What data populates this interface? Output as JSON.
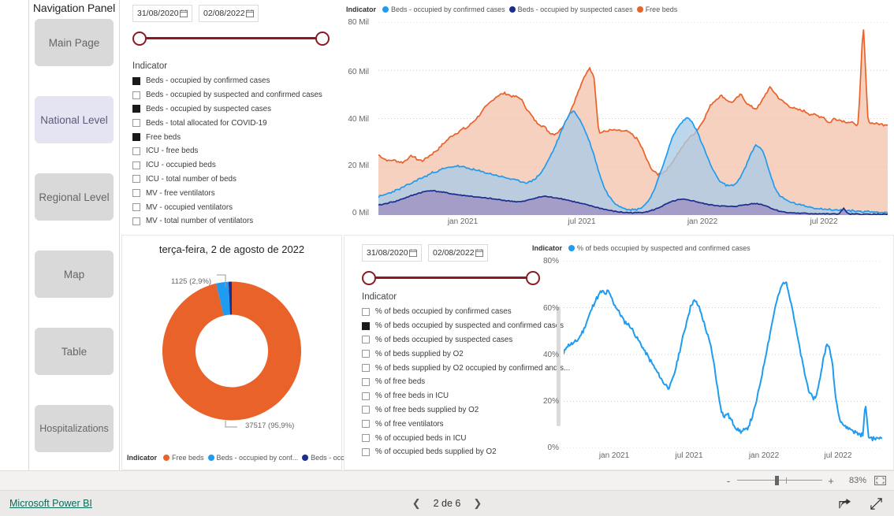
{
  "nav": {
    "title": "Navigation Panel",
    "items": [
      {
        "label": "Main Page",
        "active": false
      },
      {
        "label": "National Level",
        "active": true
      },
      {
        "label": "Regional Level",
        "active": false
      },
      {
        "label": "Map",
        "active": false
      },
      {
        "label": "Table",
        "active": false
      },
      {
        "label": "Hospitalizations",
        "active": false
      }
    ]
  },
  "slicer_top": {
    "start_date": "31/08/2020",
    "end_date": "02/08/2022",
    "indicator_header": "Indicator",
    "indicators": [
      {
        "label": "Beds - occupied by confirmed cases",
        "checked": true
      },
      {
        "label": "Beds - occupied by suspected and confirmed cases",
        "checked": false
      },
      {
        "label": "Beds - occupied by suspected cases",
        "checked": true
      },
      {
        "label": "Beds - total allocated for COVID-19",
        "checked": false
      },
      {
        "label": "Free beds",
        "checked": true
      },
      {
        "label": "ICU - free beds",
        "checked": false
      },
      {
        "label": "ICU - occupied beds",
        "checked": false
      },
      {
        "label": "ICU - total number of beds",
        "checked": false
      },
      {
        "label": "MV - free ventilators",
        "checked": false
      },
      {
        "label": "MV - occupied ventilators",
        "checked": false
      },
      {
        "label": "MV - total number of ventilators",
        "checked": false
      }
    ]
  },
  "slicer_bottom": {
    "start_date": "31/08/2020",
    "end_date": "02/08/2022",
    "indicator_header": "Indicator",
    "indicators": [
      {
        "label": "% of beds occupied by confirmed cases",
        "checked": false
      },
      {
        "label": "% of beds occupied by suspected and confirmed cases",
        "checked": true
      },
      {
        "label": "% of beds occupied by suspected cases",
        "checked": false
      },
      {
        "label": "% of beds supplied by O2",
        "checked": false
      },
      {
        "label": "% of beds supplied by O2 occupied by confirmed and s...",
        "checked": false
      },
      {
        "label": "% of free beds",
        "checked": false
      },
      {
        "label": "% of free beds in ICU",
        "checked": false
      },
      {
        "label": "% of free beds supplied by O2",
        "checked": false
      },
      {
        "label": "% of free ventilators",
        "checked": false
      },
      {
        "label": "% of occupied beds in ICU",
        "checked": false
      },
      {
        "label": "% of occupied beds supplied by O2",
        "checked": false
      }
    ]
  },
  "colors": {
    "orange": "#E8622A",
    "orange_fill": "#F5C4AE",
    "blue": "#1F9BF0",
    "blue_fill": "#9FC8E8",
    "navy": "#1B2E8E",
    "navy_fill": "#9D8FC0",
    "accent_red": "#8B1A24",
    "nav_active": "#E4E4F2",
    "nav_button": "#D9D9D9",
    "brand_green": "#096B5A"
  },
  "chart_area": {
    "type": "area",
    "legend_title": "Indicator",
    "legend_position": "top",
    "series": [
      {
        "name": "Beds - occupied by confirmed cases",
        "color": "#1F9BF0"
      },
      {
        "name": "Beds - occupied by suspected cases",
        "color": "#1B2E8E"
      },
      {
        "name": "Free beds",
        "color": "#E8622A"
      }
    ],
    "ylabel": "",
    "xlabel": "",
    "ylim": [
      0,
      80000
    ],
    "yticks": [
      "0 Mil",
      "20 Mil",
      "40 Mil",
      "60 Mil",
      "80 Mil"
    ],
    "ytick_values": [
      0,
      20000,
      40000,
      60000,
      80000
    ],
    "xticks": [
      "jan 2021",
      "jul 2021",
      "jan 2022",
      "jul 2022"
    ],
    "grid": true,
    "x_start": "2020-08-31",
    "x_end": "2022-08-02",
    "data": {
      "free_beds": [
        25000,
        23500,
        22500,
        22800,
        22200,
        21800,
        23500,
        24500,
        23000,
        22500,
        24000,
        25500,
        27000,
        29000,
        31000,
        33000,
        34000,
        35500,
        36000,
        38000,
        40000,
        42500,
        45000,
        47000,
        49000,
        50000,
        50500,
        49500,
        49000,
        48500,
        45000,
        42000,
        39000,
        37500,
        36500,
        34000,
        33500,
        35000,
        38000,
        42000,
        47000,
        52000,
        57000,
        61000,
        58000,
        34000,
        34500,
        35000,
        35200,
        35000,
        34800,
        34500,
        33000,
        31000,
        27000,
        22000,
        18500,
        17000,
        17500,
        19000,
        22000,
        25000,
        28000,
        31000,
        33000,
        35000,
        38000,
        42000,
        46000,
        48000,
        49500,
        48000,
        46500,
        48000,
        50000,
        47000,
        45000,
        44000,
        46000,
        50000,
        53000,
        50500,
        48000,
        46500,
        45000,
        44000,
        43500,
        43000,
        42000,
        41500,
        41000,
        40500,
        38000,
        40000,
        39500,
        39000,
        38500,
        38000,
        37500,
        80000,
        38500,
        38000,
        37800,
        37600,
        37517
      ],
      "occupied_confirmed": [
        7500,
        8200,
        9000,
        9800,
        10500,
        11500,
        12500,
        13500,
        14800,
        15500,
        16500,
        17500,
        18200,
        19000,
        19500,
        20000,
        20300,
        20000,
        19500,
        19000,
        18500,
        18000,
        17500,
        17000,
        16500,
        16000,
        15500,
        15000,
        14500,
        14000,
        13500,
        13800,
        15000,
        17000,
        20000,
        24000,
        28000,
        33000,
        38000,
        42000,
        43000,
        40000,
        36000,
        31000,
        25000,
        18000,
        12000,
        8000,
        5500,
        4000,
        3000,
        2500,
        2200,
        2500,
        3500,
        5500,
        9000,
        14000,
        20000,
        26000,
        32000,
        36000,
        38500,
        40500,
        39000,
        35000,
        30000,
        25000,
        20000,
        16000,
        13500,
        12500,
        12000,
        13000,
        16000,
        20000,
        25000,
        29000,
        28000,
        24000,
        17000,
        11000,
        8000,
        6500,
        5500,
        4800,
        4200,
        3800,
        3400,
        3000,
        2700,
        2500,
        2300,
        2100,
        2000,
        1900,
        1800,
        1700,
        1600,
        1500,
        1400,
        1300,
        1250,
        1180,
        1125
      ],
      "occupied_suspected": [
        4000,
        4500,
        5000,
        5500,
        6000,
        6800,
        7500,
        8200,
        9000,
        9500,
        10000,
        10200,
        9800,
        9500,
        9200,
        8800,
        8500,
        8200,
        8000,
        7800,
        7500,
        7200,
        7000,
        6800,
        6500,
        6300,
        6000,
        5800,
        5600,
        5500,
        5800,
        6500,
        7000,
        7500,
        7800,
        7500,
        7200,
        7000,
        6500,
        6000,
        5500,
        5000,
        4500,
        4000,
        3500,
        3000,
        2500,
        2000,
        1600,
        1300,
        1100,
        1000,
        950,
        1000,
        1200,
        1500,
        2000,
        2800,
        3800,
        4800,
        5600,
        6200,
        6500,
        6300,
        6000,
        5500,
        5000,
        4500,
        4200,
        4000,
        3800,
        3600,
        3500,
        3700,
        4000,
        4300,
        4600,
        4800,
        4500,
        4000,
        3000,
        2200,
        1600,
        1200,
        1000,
        850,
        750,
        680,
        620,
        580,
        540,
        500,
        480,
        450,
        430,
        2800,
        410,
        390,
        370,
        350,
        330,
        320,
        310,
        300,
        290
      ]
    }
  },
  "chart_donut": {
    "type": "pie",
    "title": "terça-feira, 2 de agosto de 2022",
    "legend_title": "Indicator",
    "legend_position": "bottom",
    "labels": [
      "Free beds",
      "Beds - occupied by conf...",
      "Beds - occupied b..."
    ],
    "values": [
      37517,
      1125,
      290
    ],
    "value_labels": [
      "37517 (95,9%)",
      "1125 (2,9%)",
      ""
    ],
    "percents": [
      95.9,
      2.9,
      1.2
    ],
    "colors": [
      "#E8622A",
      "#1F9BF0",
      "#1B2E8E"
    ]
  },
  "chart_line": {
    "type": "line",
    "legend_title": "Indicator",
    "legend_position": "top",
    "series": [
      {
        "name": "% of beds occupied by suspected and confirmed cases",
        "color": "#1F9BF0"
      }
    ],
    "ylabel": "",
    "xlabel": "",
    "ylim": [
      0,
      80
    ],
    "yticks": [
      "0%",
      "20%",
      "40%",
      "60%",
      "80%"
    ],
    "ytick_values": [
      0,
      20,
      40,
      60,
      80
    ],
    "xticks": [
      "jan 2021",
      "jul 2021",
      "jan 2022",
      "jul 2022"
    ],
    "grid": true,
    "x_start": "2020-08-31",
    "x_end": "2022-08-02",
    "values": [
      40,
      43.5,
      44,
      44.5,
      45,
      46,
      48,
      50,
      53,
      56,
      59,
      62,
      64,
      66,
      67,
      65.5,
      67,
      65,
      62,
      60,
      58,
      56,
      54,
      53,
      52,
      50,
      48,
      46,
      44,
      42,
      40,
      38,
      36,
      34,
      32,
      30,
      28,
      27,
      26,
      28,
      32,
      37,
      42,
      47,
      52,
      57,
      61,
      63,
      62,
      60,
      56,
      52,
      48,
      44,
      38,
      30,
      22,
      16,
      13,
      15,
      13,
      11,
      9,
      8,
      7,
      7.5,
      8,
      10,
      13,
      17,
      22,
      28,
      34,
      40,
      46,
      52,
      58,
      63,
      67,
      70,
      71,
      68,
      63,
      57,
      50,
      44,
      38,
      32,
      27,
      23,
      21,
      22,
      26,
      33,
      40,
      44,
      43,
      36,
      24,
      16,
      12,
      10,
      9,
      8.5,
      8,
      7,
      6.5,
      6,
      5.5,
      19.5,
      5,
      4.5,
      4.2,
      4,
      4.5,
      5
    ]
  },
  "statusbar": {
    "zoom_percent": "83%",
    "zoom_out_label": "-",
    "zoom_in_label": "+",
    "fit_icon": "fit-to-page-icon"
  },
  "footer": {
    "brand": "Microsoft Power BI",
    "page_label": "2 de 6",
    "prev_icon": "chevron-left-icon",
    "next_icon": "chevron-right-icon",
    "share_icon": "share-icon",
    "fullscreen_icon": "fullscreen-icon"
  }
}
